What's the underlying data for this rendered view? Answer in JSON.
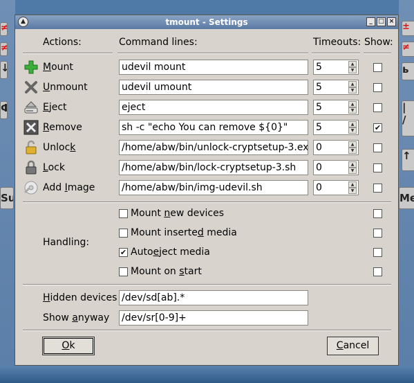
{
  "background": {
    "left_keys": [
      "≠",
      "≠",
      "↓",
      "Ф",
      "Su"
    ],
    "right_keys": [
      "±",
      "≠",
      "ь",
      "|",
      "/",
      "↑",
      "Me"
    ]
  },
  "window": {
    "title": "tmount - Settings",
    "controls": [
      "_",
      "□",
      "×"
    ]
  },
  "headers": {
    "actions": "Actions:",
    "command_lines": "Command lines:",
    "timeouts": "Timeouts:",
    "show": "Show:"
  },
  "actions": [
    {
      "pre": "",
      "ul": "M",
      "post": "ount",
      "command": "udevil mount",
      "timeout": "5",
      "show": false,
      "icon": "mount-plus-icon"
    },
    {
      "pre": "",
      "ul": "U",
      "post": "nmount",
      "command": "udevil umount",
      "timeout": "5",
      "show": false,
      "icon": "unmount-x-icon"
    },
    {
      "pre": "",
      "ul": "E",
      "post": "ject",
      "command": "eject",
      "timeout": "5",
      "show": false,
      "icon": "eject-drive-icon"
    },
    {
      "pre": "",
      "ul": "R",
      "post": "emove",
      "command": "sh -c \"echo You can remove ${0}\"",
      "timeout": "5",
      "show": true,
      "icon": "remove-x-icon"
    },
    {
      "pre": "Unloc",
      "ul": "k",
      "post": "",
      "command": "/home/abw/bin/unlock-cryptsetup-3.exp",
      "timeout": "0",
      "show": false,
      "icon": "unlock-padlock-icon"
    },
    {
      "pre": "",
      "ul": "L",
      "post": "ock",
      "command": "/home/abw/bin/lock-cryptsetup-3.sh",
      "timeout": "0",
      "show": false,
      "icon": "lock-padlock-icon"
    },
    {
      "pre": "Add ",
      "ul": "I",
      "post": "mage",
      "command": "/home/abw/bin/img-udevil.sh",
      "timeout": "0",
      "show": false,
      "icon": "add-image-icon"
    }
  ],
  "handling": {
    "label": "Handling:",
    "options": [
      {
        "pre": "Mount ",
        "ul": "n",
        "post": "ew devices",
        "checked": false,
        "show": false
      },
      {
        "pre": "Mount inserte",
        "ul": "d",
        "post": " media",
        "checked": false,
        "show": false
      },
      {
        "pre": "Auto",
        "ul": "e",
        "post": "ject media",
        "checked": true,
        "show": false
      },
      {
        "pre": "Mount on ",
        "ul": "s",
        "post": "tart",
        "checked": false,
        "show": false
      }
    ]
  },
  "hidden_devices": {
    "pre": "",
    "ul": "H",
    "post": "idden devices",
    "value": "/dev/sd[ab].*"
  },
  "show_anyway": {
    "pre": "Show ",
    "ul": "a",
    "post": "nyway",
    "value": "/dev/sr[0-9]+"
  },
  "buttons": {
    "ok": {
      "pre": "",
      "ul": "O",
      "post": "k"
    },
    "cancel": {
      "pre": "",
      "ul": "C",
      "post": "ancel"
    }
  }
}
